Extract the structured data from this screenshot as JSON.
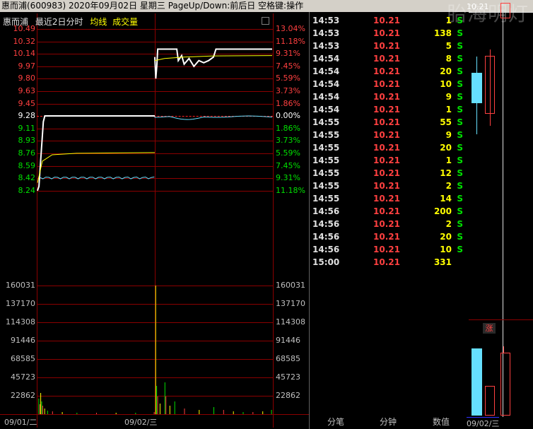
{
  "title": {
    "text": "惠而浦(600983)  2020年09月02日  星期三  PageUp/Down:前后日  空格键:操作",
    "watermark": "胎海明灯"
  },
  "legend": {
    "name": "惠而浦",
    "period": "最近2日分时",
    "avg": "均线",
    "vol": "成交量"
  },
  "price_axis": {
    "left": [
      "10.49",
      "10.32",
      "10.14",
      "9.97",
      "9.80",
      "9.63",
      "9.45",
      "9.28",
      "9.11",
      "8.93",
      "8.76",
      "8.59",
      "8.42",
      "8.24"
    ],
    "right": [
      "13.04%",
      "11.18%",
      "9.31%",
      "7.45%",
      "5.59%",
      "3.73%",
      "1.86%",
      "0.00%",
      "1.86%",
      "3.73%",
      "5.59%",
      "7.45%",
      "9.31%",
      "11.18%"
    ]
  },
  "volume_axis": {
    "left": [
      "160031",
      "137170",
      "114308",
      "91446",
      "68585",
      "45723",
      "22862"
    ],
    "right": [
      "160031",
      "137170",
      "114308",
      "91446",
      "68585",
      "45723",
      "22862"
    ]
  },
  "dates": [
    "09/01/二",
    "09/02/三"
  ],
  "trades": [
    {
      "time": "14:53",
      "price": "10.21",
      "vol": "1",
      "side": "S"
    },
    {
      "time": "14:53",
      "price": "10.21",
      "vol": "138",
      "side": "S"
    },
    {
      "time": "14:53",
      "price": "10.21",
      "vol": "5",
      "side": "S"
    },
    {
      "time": "14:54",
      "price": "10.21",
      "vol": "8",
      "side": "S"
    },
    {
      "time": "14:54",
      "price": "10.21",
      "vol": "20",
      "side": "S"
    },
    {
      "time": "14:54",
      "price": "10.21",
      "vol": "10",
      "side": "S"
    },
    {
      "time": "14:54",
      "price": "10.21",
      "vol": "9",
      "side": "S"
    },
    {
      "time": "14:54",
      "price": "10.21",
      "vol": "1",
      "side": "S"
    },
    {
      "time": "14:55",
      "price": "10.21",
      "vol": "55",
      "side": "S"
    },
    {
      "time": "14:55",
      "price": "10.21",
      "vol": "9",
      "side": "S"
    },
    {
      "time": "14:55",
      "price": "10.21",
      "vol": "20",
      "side": "S"
    },
    {
      "time": "14:55",
      "price": "10.21",
      "vol": "1",
      "side": "S"
    },
    {
      "time": "14:55",
      "price": "10.21",
      "vol": "12",
      "side": "S"
    },
    {
      "time": "14:55",
      "price": "10.21",
      "vol": "2",
      "side": "S"
    },
    {
      "time": "14:55",
      "price": "10.21",
      "vol": "14",
      "side": "S"
    },
    {
      "time": "14:56",
      "price": "10.21",
      "vol": "200",
      "side": "S"
    },
    {
      "time": "14:56",
      "price": "10.21",
      "vol": "2",
      "side": "S"
    },
    {
      "time": "14:56",
      "price": "10.21",
      "vol": "20",
      "side": "S"
    },
    {
      "time": "14:56",
      "price": "10.21",
      "vol": "10",
      "side": "S"
    },
    {
      "time": "15:00",
      "price": "10.21",
      "vol": "331",
      "side": ""
    }
  ],
  "tabs": [
    "分笔",
    "分钟",
    "数值"
  ],
  "kline": {
    "price_label": "10.21",
    "badge": "涨",
    "date": "09/02/三"
  },
  "colors": {
    "grid": "#8b0000",
    "up": "#ff4040",
    "down": "#00e000",
    "price_line": "#ffffff",
    "avg_line": "#ffff00",
    "cyan": "#66e0ff"
  },
  "chart_data": {
    "type": "line",
    "title": "最近2日分时",
    "prev_close": 9.28,
    "series": [
      {
        "name": "09/01 price",
        "points": [
          [
            0,
            8.24
          ],
          [
            3,
            8.3
          ],
          [
            6,
            8.6
          ],
          [
            9,
            8.9
          ],
          [
            12,
            9.2
          ],
          [
            15,
            9.28
          ],
          [
            40,
            9.28
          ],
          [
            80,
            9.28
          ],
          [
            120,
            9.28
          ],
          [
            160,
            9.28
          ],
          [
            200,
            9.28
          ],
          [
            240,
            9.28
          ]
        ]
      },
      {
        "name": "09/01 均线",
        "points": [
          [
            0,
            8.35
          ],
          [
            10,
            8.65
          ],
          [
            30,
            8.74
          ],
          [
            80,
            8.76
          ],
          [
            160,
            8.765
          ],
          [
            240,
            8.77
          ]
        ]
      },
      {
        "name": "09/02 price",
        "points": [
          [
            240,
            10.1
          ],
          [
            242,
            9.8
          ],
          [
            244,
            9.97
          ],
          [
            246,
            10.21
          ],
          [
            260,
            10.21
          ],
          [
            285,
            10.21
          ],
          [
            288,
            10.05
          ],
          [
            295,
            10.12
          ],
          [
            300,
            10.0
          ],
          [
            310,
            10.08
          ],
          [
            320,
            9.97
          ],
          [
            330,
            10.05
          ],
          [
            340,
            10.02
          ],
          [
            350,
            10.05
          ],
          [
            360,
            10.1
          ],
          [
            365,
            10.21
          ],
          [
            480,
            10.21
          ]
        ]
      },
      {
        "name": "09/02 均线",
        "points": [
          [
            240,
            10.05
          ],
          [
            260,
            10.08
          ],
          [
            300,
            10.1
          ],
          [
            360,
            10.115
          ],
          [
            480,
            10.12
          ]
        ]
      }
    ],
    "ylim": [
      8.24,
      10.49
    ]
  }
}
